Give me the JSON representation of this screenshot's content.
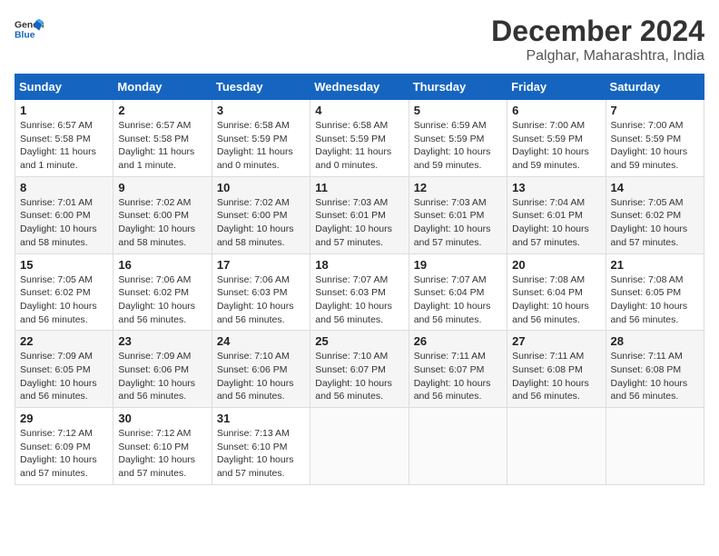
{
  "header": {
    "logo_line1": "General",
    "logo_line2": "Blue",
    "main_title": "December 2024",
    "subtitle": "Palghar, Maharashtra, India"
  },
  "calendar": {
    "days_of_week": [
      "Sunday",
      "Monday",
      "Tuesday",
      "Wednesday",
      "Thursday",
      "Friday",
      "Saturday"
    ],
    "weeks": [
      [
        {
          "day": "1",
          "info": "Sunrise: 6:57 AM\nSunset: 5:58 PM\nDaylight: 11 hours and 1 minute."
        },
        {
          "day": "2",
          "info": "Sunrise: 6:57 AM\nSunset: 5:58 PM\nDaylight: 11 hours and 1 minute."
        },
        {
          "day": "3",
          "info": "Sunrise: 6:58 AM\nSunset: 5:59 PM\nDaylight: 11 hours and 0 minutes."
        },
        {
          "day": "4",
          "info": "Sunrise: 6:58 AM\nSunset: 5:59 PM\nDaylight: 11 hours and 0 minutes."
        },
        {
          "day": "5",
          "info": "Sunrise: 6:59 AM\nSunset: 5:59 PM\nDaylight: 10 hours and 59 minutes."
        },
        {
          "day": "6",
          "info": "Sunrise: 7:00 AM\nSunset: 5:59 PM\nDaylight: 10 hours and 59 minutes."
        },
        {
          "day": "7",
          "info": "Sunrise: 7:00 AM\nSunset: 5:59 PM\nDaylight: 10 hours and 59 minutes."
        }
      ],
      [
        {
          "day": "8",
          "info": "Sunrise: 7:01 AM\nSunset: 6:00 PM\nDaylight: 10 hours and 58 minutes."
        },
        {
          "day": "9",
          "info": "Sunrise: 7:02 AM\nSunset: 6:00 PM\nDaylight: 10 hours and 58 minutes."
        },
        {
          "day": "10",
          "info": "Sunrise: 7:02 AM\nSunset: 6:00 PM\nDaylight: 10 hours and 58 minutes."
        },
        {
          "day": "11",
          "info": "Sunrise: 7:03 AM\nSunset: 6:01 PM\nDaylight: 10 hours and 57 minutes."
        },
        {
          "day": "12",
          "info": "Sunrise: 7:03 AM\nSunset: 6:01 PM\nDaylight: 10 hours and 57 minutes."
        },
        {
          "day": "13",
          "info": "Sunrise: 7:04 AM\nSunset: 6:01 PM\nDaylight: 10 hours and 57 minutes."
        },
        {
          "day": "14",
          "info": "Sunrise: 7:05 AM\nSunset: 6:02 PM\nDaylight: 10 hours and 57 minutes."
        }
      ],
      [
        {
          "day": "15",
          "info": "Sunrise: 7:05 AM\nSunset: 6:02 PM\nDaylight: 10 hours and 56 minutes."
        },
        {
          "day": "16",
          "info": "Sunrise: 7:06 AM\nSunset: 6:02 PM\nDaylight: 10 hours and 56 minutes."
        },
        {
          "day": "17",
          "info": "Sunrise: 7:06 AM\nSunset: 6:03 PM\nDaylight: 10 hours and 56 minutes."
        },
        {
          "day": "18",
          "info": "Sunrise: 7:07 AM\nSunset: 6:03 PM\nDaylight: 10 hours and 56 minutes."
        },
        {
          "day": "19",
          "info": "Sunrise: 7:07 AM\nSunset: 6:04 PM\nDaylight: 10 hours and 56 minutes."
        },
        {
          "day": "20",
          "info": "Sunrise: 7:08 AM\nSunset: 6:04 PM\nDaylight: 10 hours and 56 minutes."
        },
        {
          "day": "21",
          "info": "Sunrise: 7:08 AM\nSunset: 6:05 PM\nDaylight: 10 hours and 56 minutes."
        }
      ],
      [
        {
          "day": "22",
          "info": "Sunrise: 7:09 AM\nSunset: 6:05 PM\nDaylight: 10 hours and 56 minutes."
        },
        {
          "day": "23",
          "info": "Sunrise: 7:09 AM\nSunset: 6:06 PM\nDaylight: 10 hours and 56 minutes."
        },
        {
          "day": "24",
          "info": "Sunrise: 7:10 AM\nSunset: 6:06 PM\nDaylight: 10 hours and 56 minutes."
        },
        {
          "day": "25",
          "info": "Sunrise: 7:10 AM\nSunset: 6:07 PM\nDaylight: 10 hours and 56 minutes."
        },
        {
          "day": "26",
          "info": "Sunrise: 7:11 AM\nSunset: 6:07 PM\nDaylight: 10 hours and 56 minutes."
        },
        {
          "day": "27",
          "info": "Sunrise: 7:11 AM\nSunset: 6:08 PM\nDaylight: 10 hours and 56 minutes."
        },
        {
          "day": "28",
          "info": "Sunrise: 7:11 AM\nSunset: 6:08 PM\nDaylight: 10 hours and 56 minutes."
        }
      ],
      [
        {
          "day": "29",
          "info": "Sunrise: 7:12 AM\nSunset: 6:09 PM\nDaylight: 10 hours and 57 minutes."
        },
        {
          "day": "30",
          "info": "Sunrise: 7:12 AM\nSunset: 6:10 PM\nDaylight: 10 hours and 57 minutes."
        },
        {
          "day": "31",
          "info": "Sunrise: 7:13 AM\nSunset: 6:10 PM\nDaylight: 10 hours and 57 minutes."
        },
        {
          "day": "",
          "info": ""
        },
        {
          "day": "",
          "info": ""
        },
        {
          "day": "",
          "info": ""
        },
        {
          "day": "",
          "info": ""
        }
      ]
    ]
  }
}
